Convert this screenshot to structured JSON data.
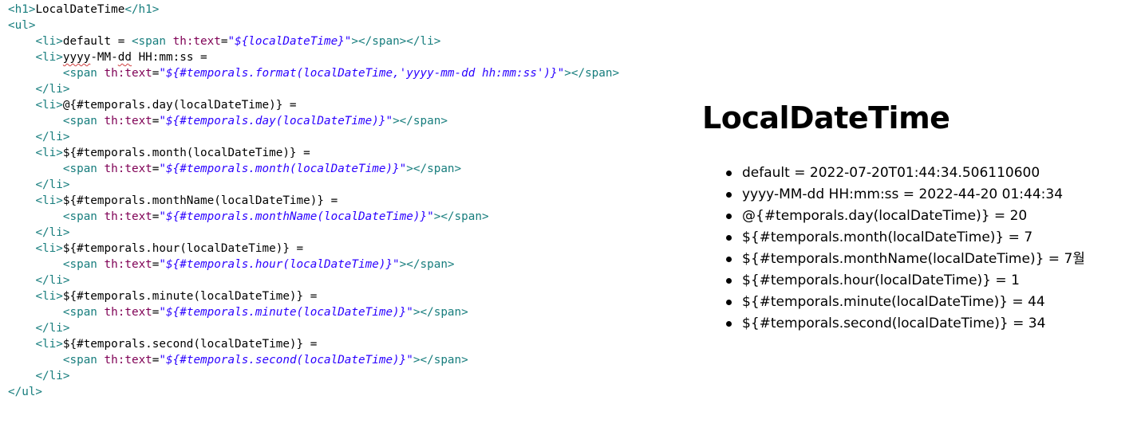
{
  "editor": {
    "lines": [
      {
        "indent": "",
        "tokens": [
          {
            "t": "<h1>",
            "c": "tag"
          },
          {
            "t": "LocalDateTime",
            "c": "txt"
          },
          {
            "t": "</h1>",
            "c": "tag"
          }
        ]
      },
      {
        "indent": "",
        "tokens": [
          {
            "t": "<ul>",
            "c": "tag"
          }
        ]
      },
      {
        "indent": "    ",
        "tokens": [
          {
            "t": "<li>",
            "c": "tag"
          },
          {
            "t": "default = ",
            "c": "txt"
          },
          {
            "t": "<span ",
            "c": "tag"
          },
          {
            "t": "th:text",
            "c": "attr"
          },
          {
            "t": "=",
            "c": "txt"
          },
          {
            "t": "\"${localDateTime}\"",
            "c": "str"
          },
          {
            "t": "></span></li>",
            "c": "tag"
          }
        ]
      },
      {
        "indent": "    ",
        "tokens": [
          {
            "t": "<li>",
            "c": "tag"
          },
          {
            "t": "yyyy",
            "c": "txt squiggle"
          },
          {
            "t": "-MM-",
            "c": "txt"
          },
          {
            "t": "dd",
            "c": "txt squiggle"
          },
          {
            "t": " HH:mm:ss =",
            "c": "txt"
          }
        ]
      },
      {
        "indent": "        ",
        "tokens": [
          {
            "t": "<span ",
            "c": "tag"
          },
          {
            "t": "th:text",
            "c": "attr"
          },
          {
            "t": "=",
            "c": "txt"
          },
          {
            "t": "\"${#temporals.format(localDateTime,'yyyy-mm-dd hh:mm:ss')}\"",
            "c": "str"
          },
          {
            "t": "></span>",
            "c": "tag"
          }
        ]
      },
      {
        "indent": "    ",
        "tokens": [
          {
            "t": "</li>",
            "c": "tag"
          }
        ]
      },
      {
        "indent": "    ",
        "tokens": [
          {
            "t": "<li>",
            "c": "tag"
          },
          {
            "t": "@{#temporals.day(localDateTime)} =",
            "c": "txt"
          }
        ]
      },
      {
        "indent": "        ",
        "tokens": [
          {
            "t": "<span ",
            "c": "tag"
          },
          {
            "t": "th:text",
            "c": "attr"
          },
          {
            "t": "=",
            "c": "txt"
          },
          {
            "t": "\"${#temporals.day(localDateTime)}\"",
            "c": "str"
          },
          {
            "t": "></span>",
            "c": "tag"
          }
        ]
      },
      {
        "indent": "    ",
        "tokens": [
          {
            "t": "</li>",
            "c": "tag"
          }
        ]
      },
      {
        "indent": "    ",
        "tokens": [
          {
            "t": "<li>",
            "c": "tag"
          },
          {
            "t": "${#temporals.month(localDateTime)} =",
            "c": "txt"
          }
        ]
      },
      {
        "indent": "        ",
        "tokens": [
          {
            "t": "<span ",
            "c": "tag"
          },
          {
            "t": "th:text",
            "c": "attr"
          },
          {
            "t": "=",
            "c": "txt"
          },
          {
            "t": "\"${#temporals.month(localDateTime)}\"",
            "c": "str"
          },
          {
            "t": "></span>",
            "c": "tag"
          }
        ]
      },
      {
        "indent": "    ",
        "tokens": [
          {
            "t": "</li>",
            "c": "tag"
          }
        ]
      },
      {
        "indent": "    ",
        "tokens": [
          {
            "t": "<li>",
            "c": "tag"
          },
          {
            "t": "${#temporals.monthName(localDateTime)} =",
            "c": "txt"
          }
        ]
      },
      {
        "indent": "        ",
        "tokens": [
          {
            "t": "<span ",
            "c": "tag"
          },
          {
            "t": "th:text",
            "c": "attr"
          },
          {
            "t": "=",
            "c": "txt"
          },
          {
            "t": "\"${#temporals.monthName(localDateTime)}\"",
            "c": "str"
          },
          {
            "t": "></span>",
            "c": "tag"
          }
        ]
      },
      {
        "indent": "    ",
        "tokens": [
          {
            "t": "</li>",
            "c": "tag"
          }
        ]
      },
      {
        "indent": "    ",
        "tokens": [
          {
            "t": "<li>",
            "c": "tag"
          },
          {
            "t": "${#temporals.hour(localDateTime)} =",
            "c": "txt"
          }
        ]
      },
      {
        "indent": "        ",
        "tokens": [
          {
            "t": "<span ",
            "c": "tag"
          },
          {
            "t": "th:text",
            "c": "attr"
          },
          {
            "t": "=",
            "c": "txt"
          },
          {
            "t": "\"${#temporals.hour(localDateTime)}\"",
            "c": "str"
          },
          {
            "t": "></span>",
            "c": "tag"
          }
        ]
      },
      {
        "indent": "    ",
        "tokens": [
          {
            "t": "</li>",
            "c": "tag"
          }
        ]
      },
      {
        "indent": "    ",
        "tokens": [
          {
            "t": "<li>",
            "c": "tag"
          },
          {
            "t": "${#temporals.minute(localDateTime)} =",
            "c": "txt"
          }
        ]
      },
      {
        "indent": "        ",
        "tokens": [
          {
            "t": "<span ",
            "c": "tag"
          },
          {
            "t": "th:text",
            "c": "attr"
          },
          {
            "t": "=",
            "c": "txt"
          },
          {
            "t": "\"${#temporals.minute(localDateTime)}\"",
            "c": "str"
          },
          {
            "t": "></span>",
            "c": "tag"
          }
        ]
      },
      {
        "indent": "    ",
        "tokens": [
          {
            "t": "</li>",
            "c": "tag"
          }
        ]
      },
      {
        "indent": "    ",
        "tokens": [
          {
            "t": "<li>",
            "c": "tag"
          },
          {
            "t": "${#temporals.second(localDateTime)} =",
            "c": "txt"
          }
        ]
      },
      {
        "indent": "        ",
        "tokens": [
          {
            "t": "<span ",
            "c": "tag"
          },
          {
            "t": "th:text",
            "c": "attr"
          },
          {
            "t": "=",
            "c": "txt"
          },
          {
            "t": "\"${#temporals.second(localDateTime)}\"",
            "c": "str"
          },
          {
            "t": "></span>",
            "c": "tag"
          }
        ]
      },
      {
        "indent": "    ",
        "tokens": [
          {
            "t": "</li>",
            "c": "tag"
          }
        ]
      },
      {
        "indent": "",
        "tokens": [
          {
            "t": "</ul>",
            "c": "tag"
          }
        ]
      }
    ]
  },
  "preview": {
    "title": "LocalDateTime",
    "items": [
      {
        "label": "default",
        "value": "2022-07-20T01:44:34.506110600"
      },
      {
        "label": "yyyy-MM-dd HH:mm:ss",
        "value": "2022-44-20 01:44:34"
      },
      {
        "label": "@{#temporals.day(localDateTime)}",
        "value": "20"
      },
      {
        "label": "${#temporals.month(localDateTime)}",
        "value": "7"
      },
      {
        "label": "${#temporals.monthName(localDateTime)}",
        "value": "7월"
      },
      {
        "label": "${#temporals.hour(localDateTime)}",
        "value": "1"
      },
      {
        "label": "${#temporals.minute(localDateTime)}",
        "value": "44"
      },
      {
        "label": "${#temporals.second(localDateTime)}",
        "value": "34"
      }
    ]
  }
}
